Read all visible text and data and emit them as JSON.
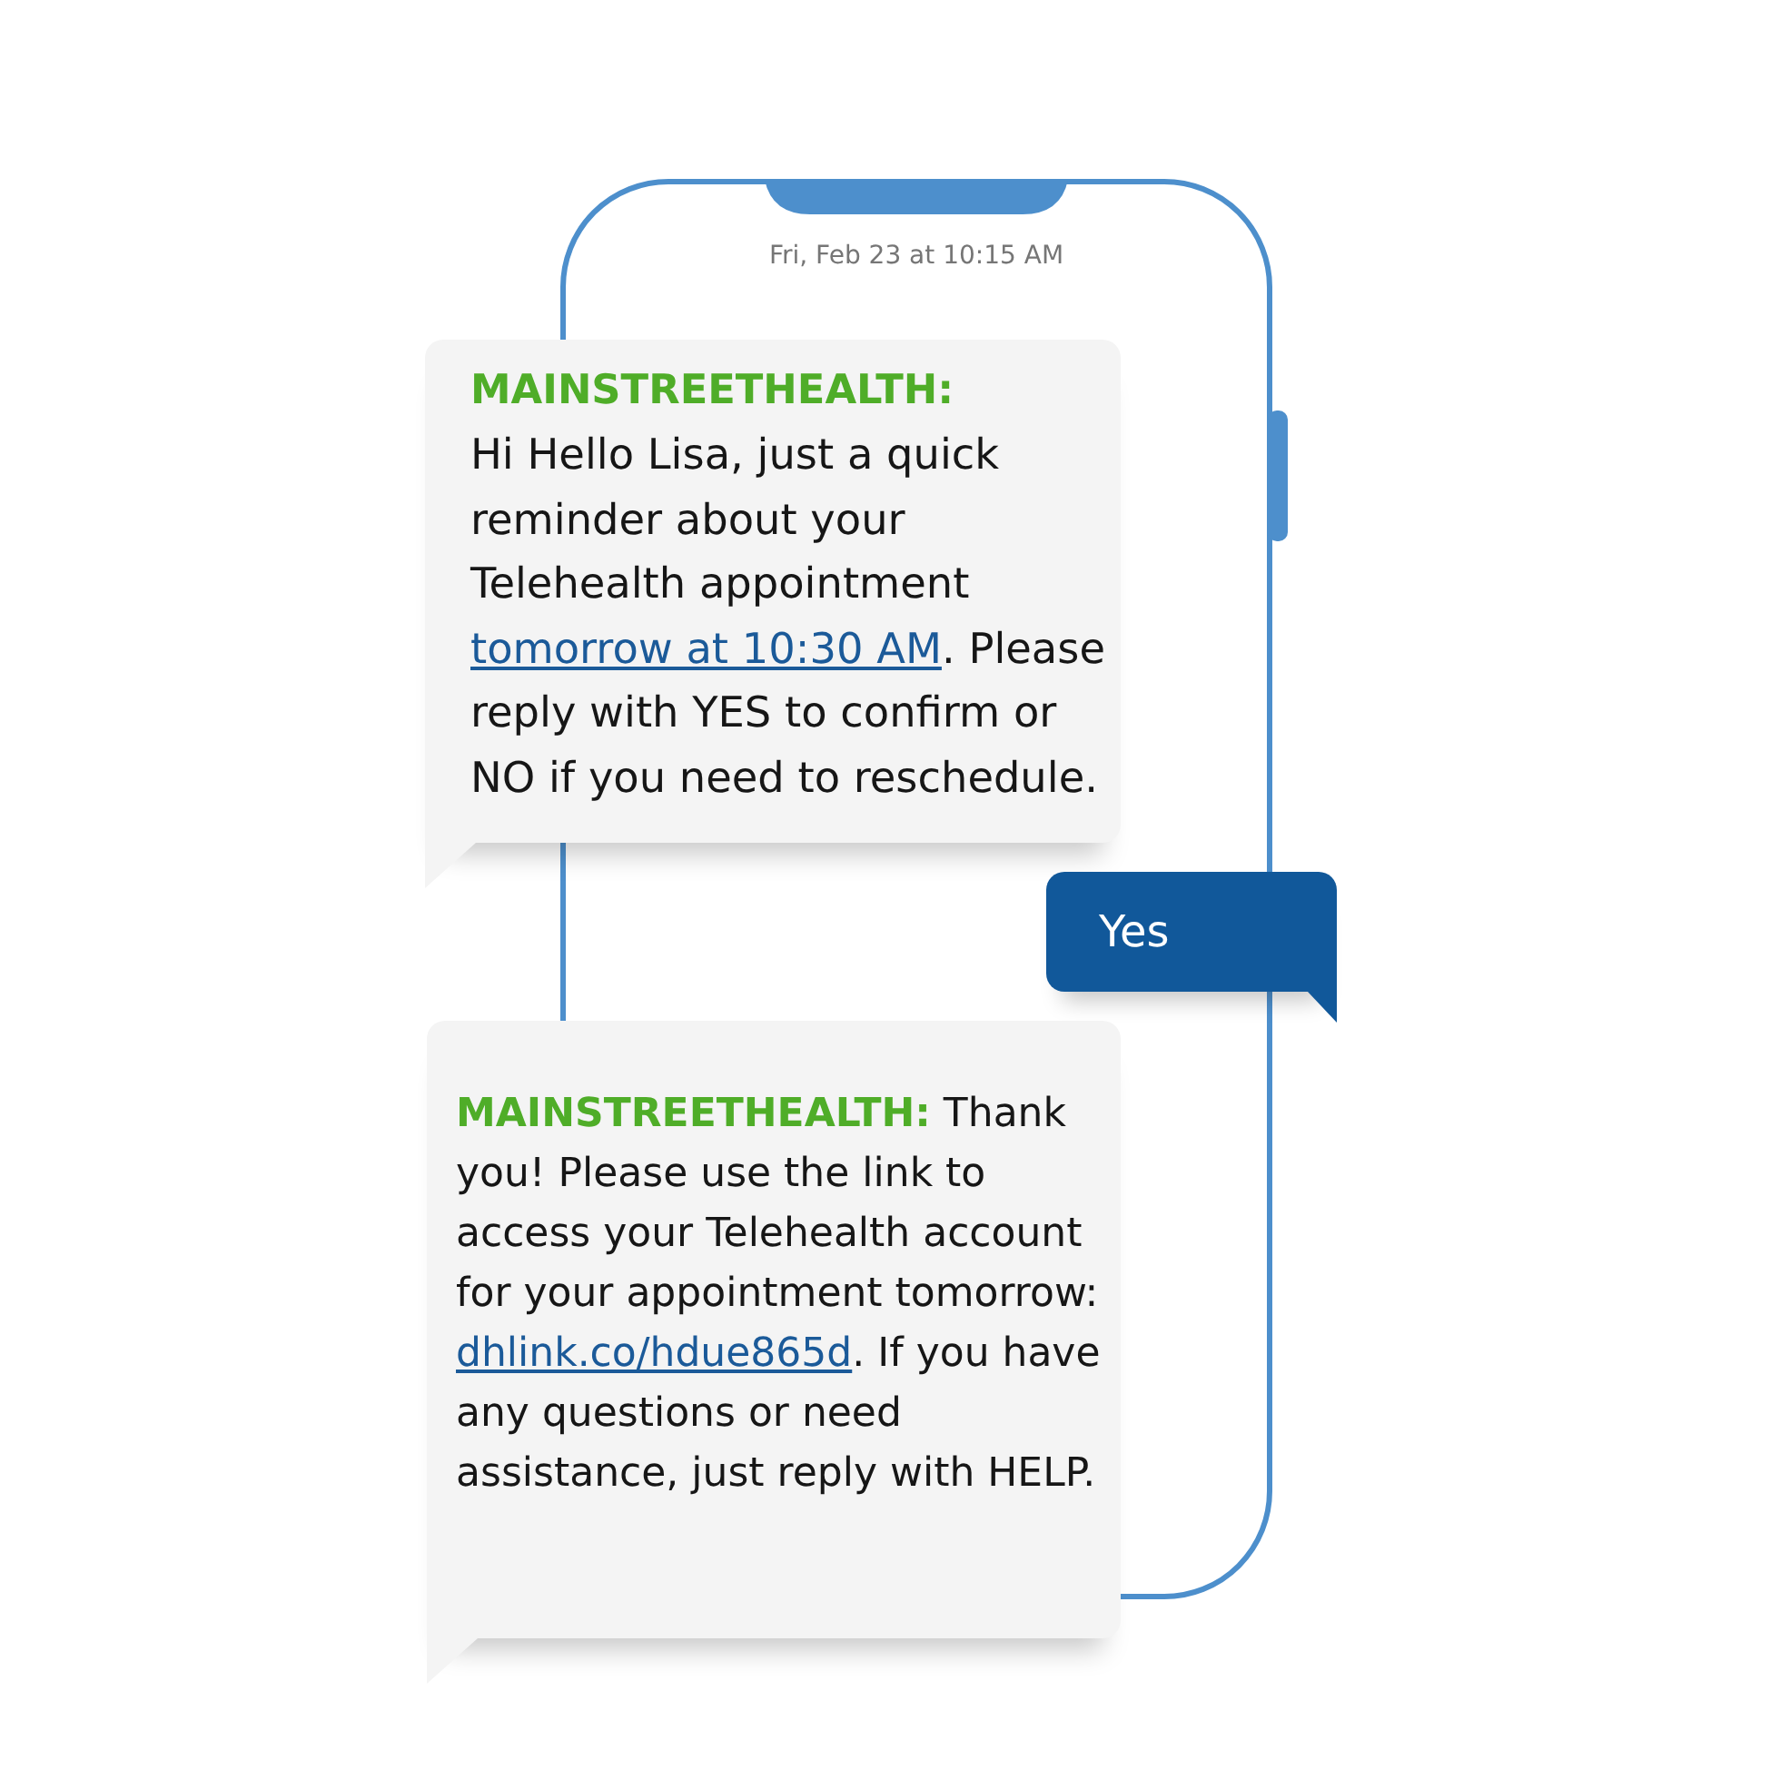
{
  "phone": {
    "timestamp": "Fri, Feb 23 at 10:15 AM"
  },
  "messages": [
    {
      "kind": "incoming",
      "sender": "MAINSTREETHEALTH:",
      "parts": [
        {
          "kind": "text",
          "text": "Hi Hello Lisa, just a quick reminder about your Telehealth appointment "
        },
        {
          "kind": "link",
          "text": "tomorrow at 10:30 AM"
        },
        {
          "kind": "text",
          "text": ". Please reply with YES to confirm or NO if you need to reschedule."
        }
      ]
    },
    {
      "kind": "outgoing",
      "parts": [
        {
          "kind": "text",
          "text": "Yes"
        }
      ]
    },
    {
      "kind": "incoming",
      "parts": [
        {
          "kind": "text",
          "text": "**MAINSTREETHEALTH:** Thank you! Please use the link to access your Telehealth account for your appointment tomorrow: "
        },
        {
          "kind": "link",
          "text": "dhlink.co/hdue865d"
        },
        {
          "kind": "text",
          "text": ". If you have any questions or need assistance, just reply with HELP."
        }
      ]
    }
  ]
}
